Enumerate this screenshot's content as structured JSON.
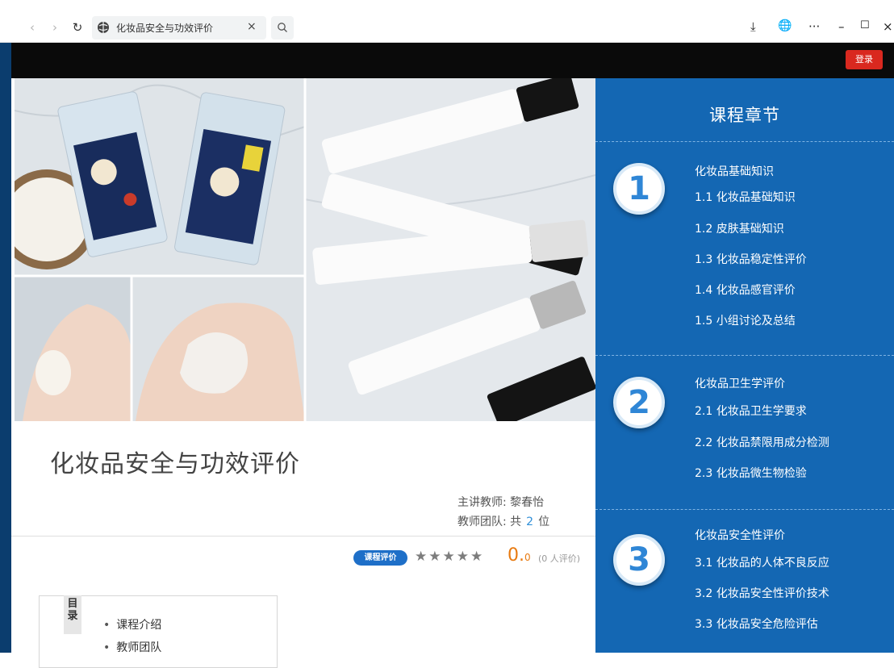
{
  "browser": {
    "tab_title": "化妆品安全与功效评价",
    "tab_close": "×",
    "nav": {
      "back": "‹",
      "forward": "›",
      "reload": "↻"
    },
    "right": {
      "download": "⤓",
      "globe": "🌐",
      "more": "···",
      "minimize": "–",
      "maximize": "☐",
      "close": "×"
    }
  },
  "header": {
    "login_label": "登录"
  },
  "course": {
    "title": "化妆品安全与功效评价",
    "teacher_label": "主讲教师:",
    "teacher_name": "黎春怡",
    "team_label": "教师团队: 共",
    "team_count": "2",
    "team_unit": "位"
  },
  "rating": {
    "badge": "课程评价",
    "stars": "★★★★★",
    "score_main": "0.",
    "score_small": "0",
    "review_count": "(0 人评价)"
  },
  "toc": {
    "tag": "目录",
    "items": [
      "课程介绍",
      "教师团队"
    ]
  },
  "chapters": {
    "title": "课程章节",
    "sections": [
      {
        "number": "1",
        "heading": "化妆品基础知识",
        "items": [
          "1.1  化妆品基础知识",
          "1.2  皮肤基础知识",
          "1.3  化妆品稳定性评价",
          "1.4  化妆品感官评价",
          "1.5  小组讨论及总结"
        ]
      },
      {
        "number": "2",
        "heading": "化妆品卫生学评价",
        "items": [
          "2.1  化妆品卫生学要求",
          "2.2  化妆品禁限用成分检测",
          "2.3  化妆品微生物检验"
        ]
      },
      {
        "number": "3",
        "heading": "化妆品安全性评价",
        "items": [
          "3.1  化妆品的人体不良反应",
          "3.2  化妆品安全性评价技术",
          "3.3  化妆品安全危险评估"
        ]
      }
    ]
  },
  "colors": {
    "chapter_panel": "#1467b3",
    "login_button": "#d9281f",
    "rating_badge": "#1e6fc8",
    "score": "#e87a10"
  }
}
